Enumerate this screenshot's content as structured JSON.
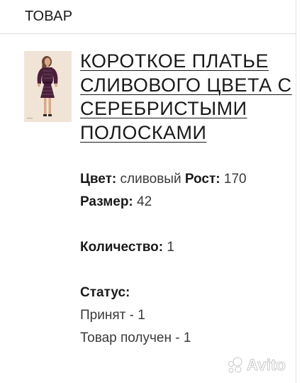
{
  "header": {
    "title": "ТОВАР"
  },
  "product": {
    "title": "КОРОТКОЕ ПЛАТЬЕ СЛИВОВОГО ЦВЕТА С СЕРЕБРИСТЫМИ ПОЛОСКАМИ",
    "image_icon": "dress-photo"
  },
  "details": {
    "color_label": "Цвет:",
    "color_value": "сливовый",
    "height_label": "Рост:",
    "height_value": "170",
    "size_label": "Размер:",
    "size_value": "42",
    "quantity_label": "Количество:",
    "quantity_value": "1",
    "status_label": "Статус:",
    "status_accepted": "Принят - 1",
    "status_received": "Товар получен - 1"
  },
  "watermark": {
    "text": "Avito",
    "icon": "avito-dots-icon"
  },
  "colors": {
    "text": "#1a1a1a",
    "divider": "#dcdcdc",
    "dress": "#4a1f3a"
  }
}
